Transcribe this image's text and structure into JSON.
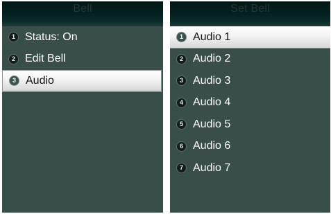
{
  "left_screen": {
    "title": "Bell",
    "items": [
      {
        "num": "1",
        "label": "Status: On",
        "selected": false
      },
      {
        "num": "2",
        "label": "Edit Bell",
        "selected": false
      },
      {
        "num": "3",
        "label": "Audio",
        "selected": true
      }
    ]
  },
  "right_screen": {
    "title": "Set Bell",
    "items": [
      {
        "num": "1",
        "label": "Audio 1",
        "selected": true
      },
      {
        "num": "2",
        "label": "Audio 2",
        "selected": false
      },
      {
        "num": "3",
        "label": "Audio 3",
        "selected": false
      },
      {
        "num": "4",
        "label": "Audio 4",
        "selected": false
      },
      {
        "num": "5",
        "label": "Audio 5",
        "selected": false
      },
      {
        "num": "6",
        "label": "Audio 6",
        "selected": false
      },
      {
        "num": "7",
        "label": "Audio 7",
        "selected": false
      }
    ]
  },
  "colors": {
    "screen_background": "#394d4a",
    "title_bar": "#052220",
    "selected_row": "#f2f2f2",
    "text": "#ffffff"
  }
}
